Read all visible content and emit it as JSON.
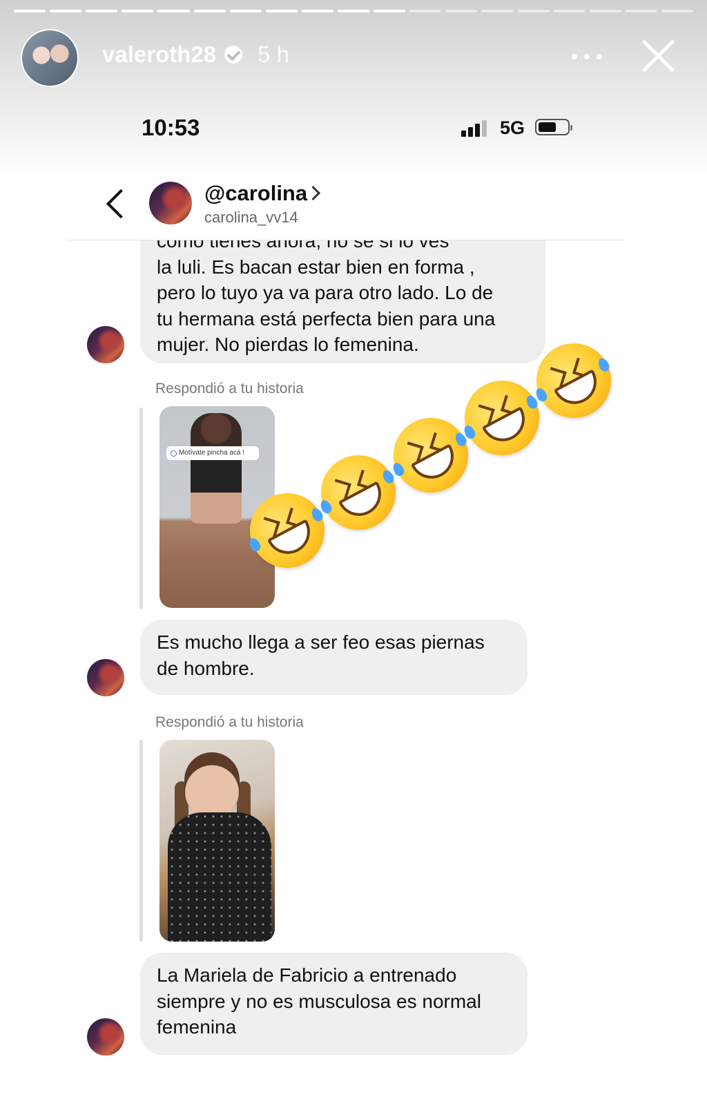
{
  "story": {
    "username": "valeroth28",
    "time_ago": "5 h",
    "progress_segments_done": 11,
    "progress_segments_total": 19
  },
  "status_bar": {
    "time": "10:53",
    "network": "5G"
  },
  "chat": {
    "name": "@carolina",
    "handle": "carolina_vv14"
  },
  "messages": [
    {
      "type": "text",
      "lines": [
        "como tienes ahora, no se si lo ves",
        "la luli. Es bacan estar bien en forma ,",
        "pero lo tuyo ya va para otro lado. Lo de",
        "tu hermana está perfecta bien para una",
        "mujer. No pierdas lo femenina."
      ]
    },
    {
      "type": "reply",
      "label": "Respondió a tu historia",
      "sticker": "Motívate pincha acá !"
    },
    {
      "type": "text",
      "lines": [
        "Es mucho llega a ser feo esas piernas",
        "de hombre."
      ]
    },
    {
      "type": "reply",
      "label": "Respondió a tu historia"
    },
    {
      "type": "text",
      "lines": [
        "La Mariela de Fabricio a entrenado",
        "siempre y no es musculosa es normal",
        "femenina"
      ]
    }
  ],
  "overlay": {
    "emoji": "rolling-on-the-floor-laughing",
    "emoji_count": 5
  }
}
